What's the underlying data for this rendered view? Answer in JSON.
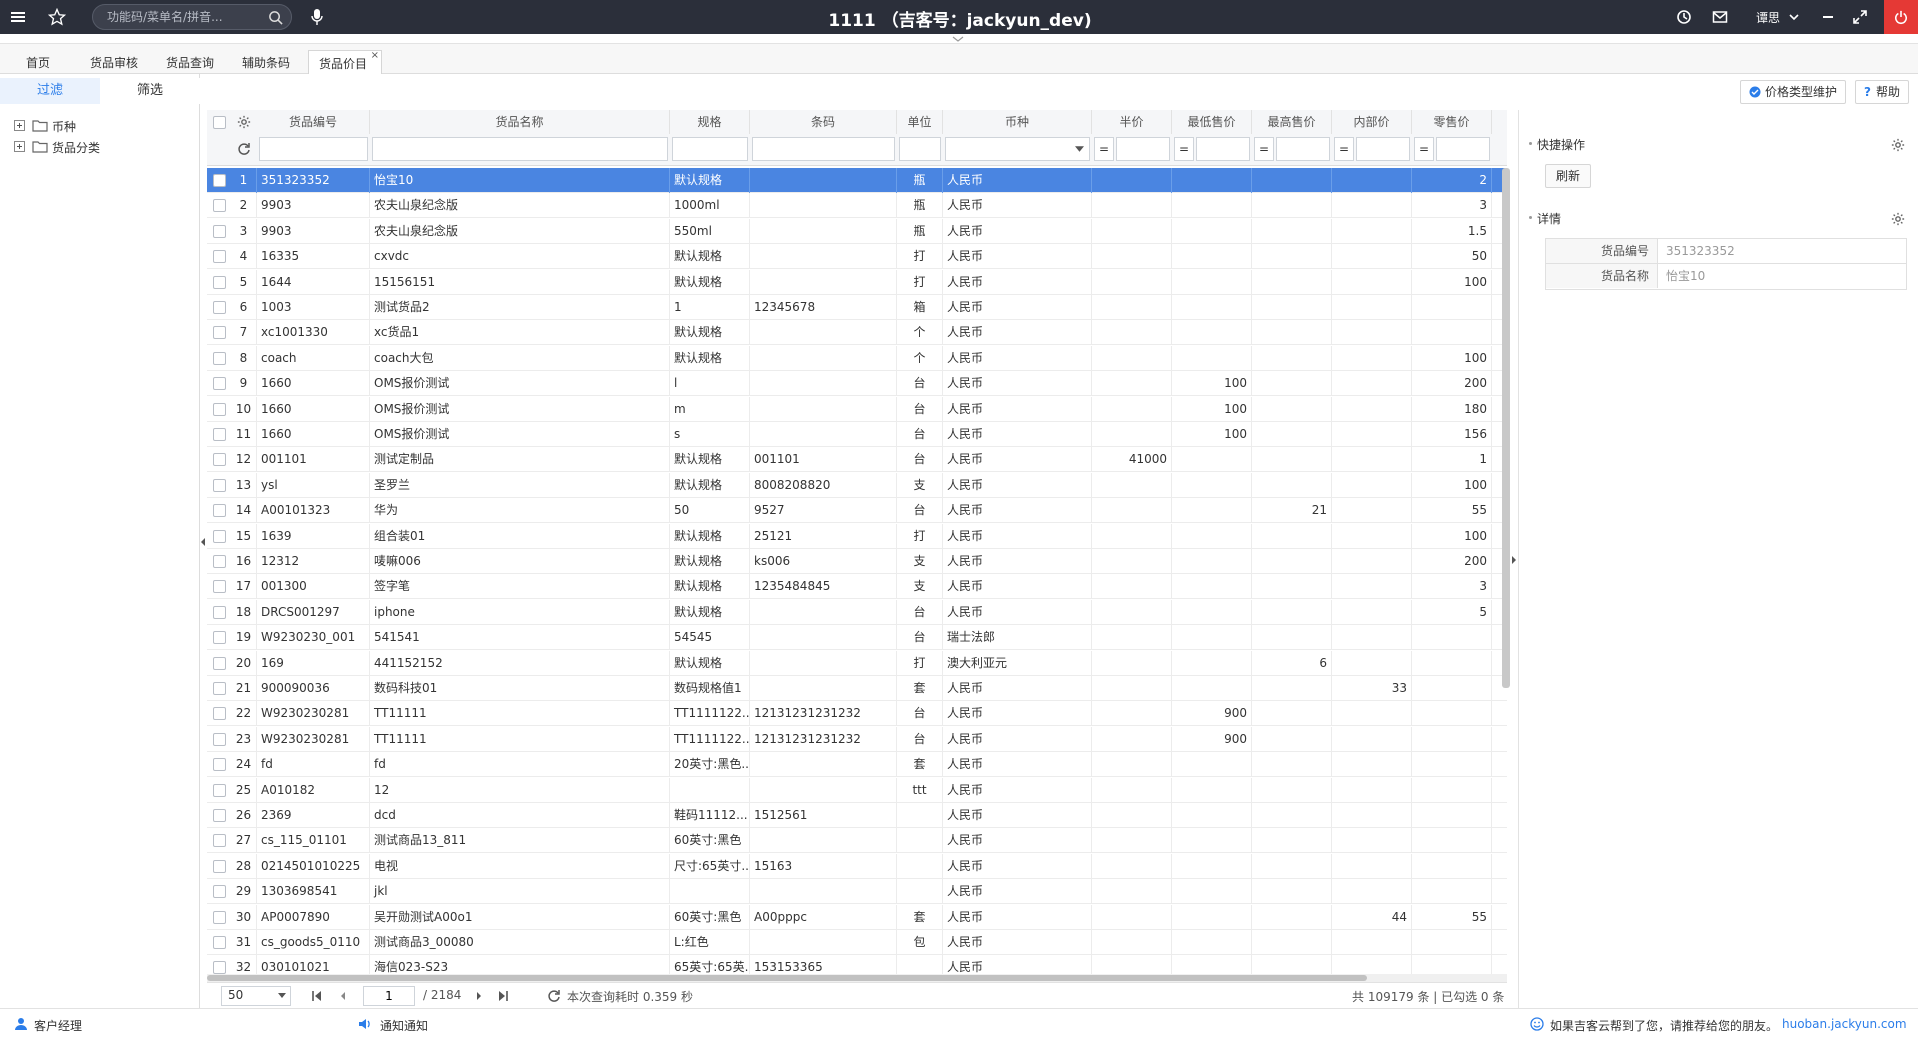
{
  "header": {
    "title": "1111 （吉客号：jackyun_dev)",
    "search_placeholder": "功能码/菜单名/拼音...",
    "user": "谭思"
  },
  "tabs": [
    {
      "label": "首页",
      "active": false
    },
    {
      "label": "货品审核",
      "active": false
    },
    {
      "label": "货品查询",
      "active": false
    },
    {
      "label": "辅助条码",
      "active": false
    },
    {
      "label": "货品价目",
      "active": true,
      "close": "×"
    }
  ],
  "left": {
    "tab_filter": "过滤",
    "tab_screen": "筛选",
    "tree": [
      {
        "label": "币种"
      },
      {
        "label": "货品分类"
      }
    ]
  },
  "toolbar": {
    "price_type_btn": "价格类型维护",
    "help_btn": "帮助"
  },
  "grid": {
    "columns": [
      "货品编号",
      "货品名称",
      "规格",
      "条码",
      "单位",
      "币种",
      "半价",
      "最低售价",
      "最高售价",
      "内部价",
      "零售价"
    ],
    "filter_eq": "=",
    "rows": [
      {
        "no": "1",
        "code": "351323352",
        "name": "怡宝10",
        "spec": "默认规格",
        "barcode": "",
        "unit": "瓶",
        "currency": "人民币",
        "half": "",
        "min": "",
        "max": "",
        "inner": "",
        "retail": "2"
      },
      {
        "no": "2",
        "code": "9903",
        "name": "农夫山泉纪念版",
        "spec": "1000ml",
        "barcode": "",
        "unit": "瓶",
        "currency": "人民币",
        "half": "",
        "min": "",
        "max": "",
        "inner": "",
        "retail": "3"
      },
      {
        "no": "3",
        "code": "9903",
        "name": "农夫山泉纪念版",
        "spec": "550ml",
        "barcode": "",
        "unit": "瓶",
        "currency": "人民币",
        "half": "",
        "min": "",
        "max": "",
        "inner": "",
        "retail": "1.5"
      },
      {
        "no": "4",
        "code": "16335",
        "name": "cxvdc",
        "spec": "默认规格",
        "barcode": "",
        "unit": "打",
        "currency": "人民币",
        "half": "",
        "min": "",
        "max": "",
        "inner": "",
        "retail": "50"
      },
      {
        "no": "5",
        "code": "1644",
        "name": "15156151",
        "spec": "默认规格",
        "barcode": "",
        "unit": "打",
        "currency": "人民币",
        "half": "",
        "min": "",
        "max": "",
        "inner": "",
        "retail": "100"
      },
      {
        "no": "6",
        "code": "1003",
        "name": "测试货品2",
        "spec": "1",
        "barcode": "12345678",
        "unit": "箱",
        "currency": "人民币",
        "half": "",
        "min": "",
        "max": "",
        "inner": "",
        "retail": ""
      },
      {
        "no": "7",
        "code": "xc1001330",
        "name": "xc货品1",
        "spec": "默认规格",
        "barcode": "",
        "unit": "个",
        "currency": "人民币",
        "half": "",
        "min": "",
        "max": "",
        "inner": "",
        "retail": ""
      },
      {
        "no": "8",
        "code": "coach",
        "name": "coach大包",
        "spec": "默认规格",
        "barcode": "",
        "unit": "个",
        "currency": "人民币",
        "half": "",
        "min": "",
        "max": "",
        "inner": "",
        "retail": "100"
      },
      {
        "no": "9",
        "code": "1660",
        "name": "OMS报价测试",
        "spec": "l",
        "barcode": "",
        "unit": "台",
        "currency": "人民币",
        "half": "",
        "min": "100",
        "max": "",
        "inner": "",
        "retail": "200"
      },
      {
        "no": "10",
        "code": "1660",
        "name": "OMS报价测试",
        "spec": "m",
        "barcode": "",
        "unit": "台",
        "currency": "人民币",
        "half": "",
        "min": "100",
        "max": "",
        "inner": "",
        "retail": "180"
      },
      {
        "no": "11",
        "code": "1660",
        "name": "OMS报价测试",
        "spec": "s",
        "barcode": "",
        "unit": "台",
        "currency": "人民币",
        "half": "",
        "min": "100",
        "max": "",
        "inner": "",
        "retail": "156"
      },
      {
        "no": "12",
        "code": "001101",
        "name": "测试定制品",
        "spec": "默认规格",
        "barcode": "001101",
        "unit": "台",
        "currency": "人民币",
        "half": "41000",
        "min": "",
        "max": "",
        "inner": "",
        "retail": "1"
      },
      {
        "no": "13",
        "code": "ysl",
        "name": "圣罗兰",
        "spec": "默认规格",
        "barcode": "8008208820",
        "unit": "支",
        "currency": "人民币",
        "half": "",
        "min": "",
        "max": "",
        "inner": "",
        "retail": "100"
      },
      {
        "no": "14",
        "code": "A00101323",
        "name": "华为",
        "spec": "50",
        "barcode": "9527",
        "unit": "台",
        "currency": "人民币",
        "half": "",
        "min": "",
        "max": "21",
        "inner": "",
        "retail": "55"
      },
      {
        "no": "15",
        "code": "1639",
        "name": "组合装01",
        "spec": "默认规格",
        "barcode": "25121",
        "unit": "打",
        "currency": "人民币",
        "half": "",
        "min": "",
        "max": "",
        "inner": "",
        "retail": "100"
      },
      {
        "no": "16",
        "code": "12312",
        "name": "唛嘛006",
        "spec": "默认规格",
        "barcode": "ks006",
        "unit": "支",
        "currency": "人民币",
        "half": "",
        "min": "",
        "max": "",
        "inner": "",
        "retail": "200"
      },
      {
        "no": "17",
        "code": "001300",
        "name": "签字笔",
        "spec": "默认规格",
        "barcode": "1235484845",
        "unit": "支",
        "currency": "人民币",
        "half": "",
        "min": "",
        "max": "",
        "inner": "",
        "retail": "3"
      },
      {
        "no": "18",
        "code": "DRCS001297",
        "name": "iphone",
        "spec": "默认规格",
        "barcode": "",
        "unit": "台",
        "currency": "人民币",
        "half": "",
        "min": "",
        "max": "",
        "inner": "",
        "retail": "5"
      },
      {
        "no": "19",
        "code": "W9230230_001",
        "name": "541541",
        "spec": "54545",
        "barcode": "",
        "unit": "台",
        "currency": "瑞士法郎",
        "half": "",
        "min": "",
        "max": "",
        "inner": "",
        "retail": ""
      },
      {
        "no": "20",
        "code": "169",
        "name": "441152152",
        "spec": "默认规格",
        "barcode": "",
        "unit": "打",
        "currency": "澳大利亚元",
        "half": "",
        "min": "",
        "max": "6",
        "inner": "",
        "retail": ""
      },
      {
        "no": "21",
        "code": "900090036",
        "name": "数码科技01",
        "spec": "数码规格值1",
        "barcode": "",
        "unit": "套",
        "currency": "人民币",
        "half": "",
        "min": "",
        "max": "",
        "inner": "33",
        "retail": ""
      },
      {
        "no": "22",
        "code": "W9230230281",
        "name": "TT11111",
        "spec": "TT1111122...",
        "barcode": "12131231231232",
        "unit": "台",
        "currency": "人民币",
        "half": "",
        "min": "900",
        "max": "",
        "inner": "",
        "retail": ""
      },
      {
        "no": "23",
        "code": "W9230230281",
        "name": "TT11111",
        "spec": "TT1111122...",
        "barcode": "12131231231232",
        "unit": "台",
        "currency": "人民币",
        "half": "",
        "min": "900",
        "max": "",
        "inner": "",
        "retail": ""
      },
      {
        "no": "24",
        "code": "fd",
        "name": "fd",
        "spec": "20英寸:黑色...",
        "barcode": "",
        "unit": "套",
        "currency": "人民币",
        "half": "",
        "min": "",
        "max": "",
        "inner": "",
        "retail": ""
      },
      {
        "no": "25",
        "code": "A010182",
        "name": "12",
        "spec": "",
        "barcode": "",
        "unit": "ttt",
        "currency": "人民币",
        "half": "",
        "min": "",
        "max": "",
        "inner": "",
        "retail": ""
      },
      {
        "no": "26",
        "code": "2369",
        "name": "dcd",
        "spec": "鞋码11112...",
        "barcode": "1512561",
        "unit": "",
        "currency": "人民币",
        "half": "",
        "min": "",
        "max": "",
        "inner": "",
        "retail": ""
      },
      {
        "no": "27",
        "code": "cs_115_01101",
        "name": "测试商品13_811",
        "spec": "60英寸:黑色",
        "barcode": "",
        "unit": "",
        "currency": "人民币",
        "half": "",
        "min": "",
        "max": "",
        "inner": "",
        "retail": ""
      },
      {
        "no": "28",
        "code": "0214501010225",
        "name": "电视",
        "spec": "尺寸:65英寸...",
        "barcode": "15163",
        "unit": "",
        "currency": "人民币",
        "half": "",
        "min": "",
        "max": "",
        "inner": "",
        "retail": ""
      },
      {
        "no": "29",
        "code": "1303698541",
        "name": "jkl",
        "spec": "",
        "barcode": "",
        "unit": "",
        "currency": "人民币",
        "half": "",
        "min": "",
        "max": "",
        "inner": "",
        "retail": ""
      },
      {
        "no": "30",
        "code": "AP0007890",
        "name": "吴开勋测试A00o1",
        "spec": "60英寸:黑色",
        "barcode": "A00pppc",
        "unit": "套",
        "currency": "人民币",
        "half": "",
        "min": "",
        "max": "",
        "inner": "44",
        "retail": "55"
      },
      {
        "no": "31",
        "code": "cs_goods5_0110",
        "name": "测试商品3_00080",
        "spec": "L:红色",
        "barcode": "",
        "unit": "包",
        "currency": "人民币",
        "half": "",
        "min": "",
        "max": "",
        "inner": "",
        "retail": ""
      },
      {
        "no": "32",
        "code": "030101021",
        "name": "海信023-S23",
        "spec": "65英寸:65英...",
        "barcode": "153153365",
        "unit": "",
        "currency": "人民币",
        "half": "",
        "min": "",
        "max": "",
        "inner": "",
        "retail": ""
      }
    ]
  },
  "pager": {
    "page_size": "50",
    "current_page": "1",
    "total_pages": "/ 2184",
    "query_time": "本次查询耗时 0.359 秒",
    "summary": "共 109179 条 | 已勾选 0 条"
  },
  "right": {
    "quick_ops": "快捷操作",
    "refresh": "刷新",
    "details": "详情",
    "detail_rows": [
      {
        "label": "货品编号",
        "value": "351323352"
      },
      {
        "label": "货品名称",
        "value": "怡宝10"
      }
    ]
  },
  "footer": {
    "manager": "客户经理",
    "notice": "通知通知",
    "recommend": "如果吉客云帮到了您，请推荐给您的朋友。",
    "link": "huoban.jackyun.com"
  },
  "colors": {
    "header_bg": "#2b2f3a",
    "selected_row": "#4a85e1",
    "accent": "#2b7de9",
    "close_red": "#e53935"
  }
}
